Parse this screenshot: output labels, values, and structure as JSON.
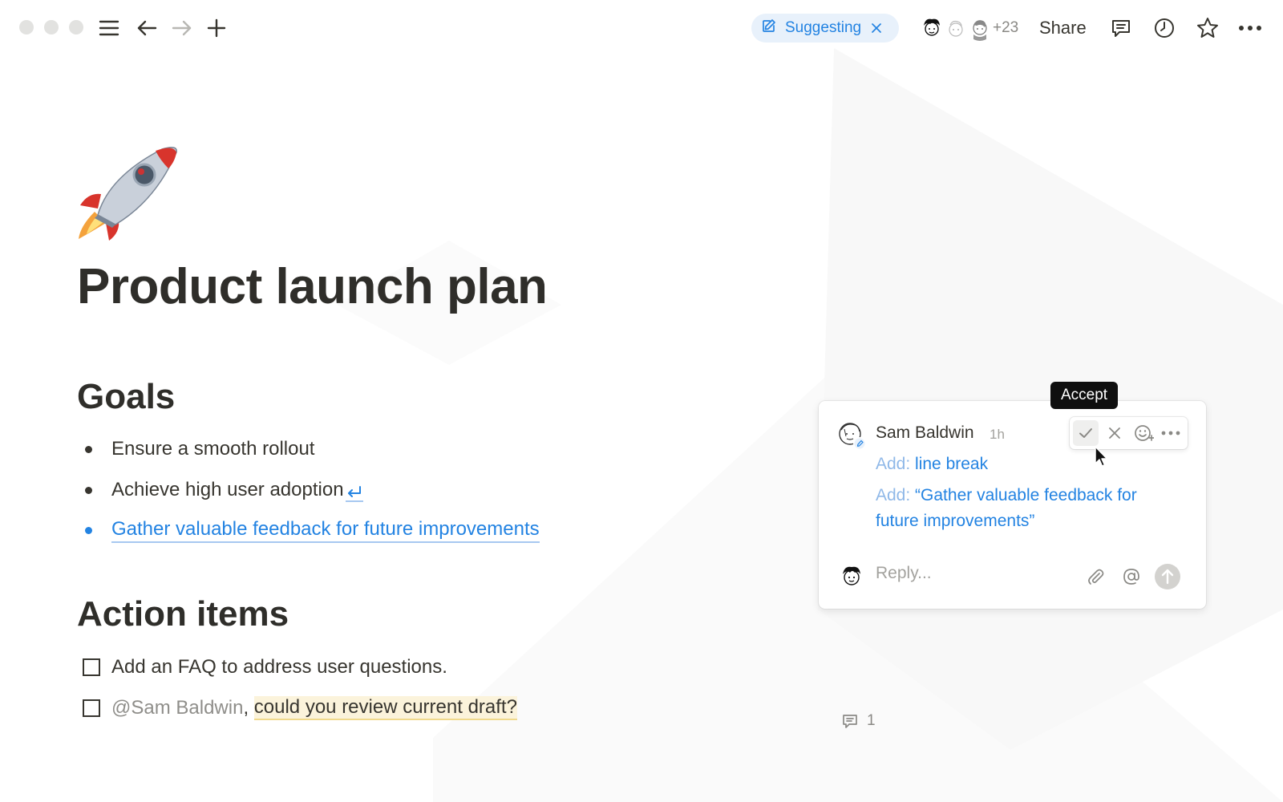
{
  "topbar": {
    "suggest_label": "Suggesting",
    "collaborators_extra": "+23",
    "share_label": "Share"
  },
  "page": {
    "icon": "rocket-emoji",
    "title": "Product launch plan"
  },
  "goals": {
    "heading": "Goals",
    "items": [
      "Ensure a smooth rollout",
      "Achieve high user adoption",
      "Gather valuable feedback for future improvements"
    ]
  },
  "actions": {
    "heading": "Action items",
    "todos": [
      {
        "text": "Add an FAQ to address user questions.",
        "checked": false
      },
      {
        "mention": "@Sam Baldwin",
        "sep": ",",
        "text": "could you review current draft?",
        "checked": false
      }
    ],
    "comment_count": "1"
  },
  "comment": {
    "author": "Sam Baldwin",
    "time": "1h",
    "suggestions": [
      {
        "kind": "Add:",
        "content": "line break"
      },
      {
        "kind": "Add:",
        "content": "“Gather valuable feedback for",
        "content_line2": "future improvements”"
      }
    ],
    "reply_placeholder": "Reply...",
    "tooltip": "Accept"
  },
  "colors": {
    "accent": "#2383e2",
    "text": "#37352f",
    "muted": "#a3a29e",
    "highlight": "#fbf3db"
  }
}
